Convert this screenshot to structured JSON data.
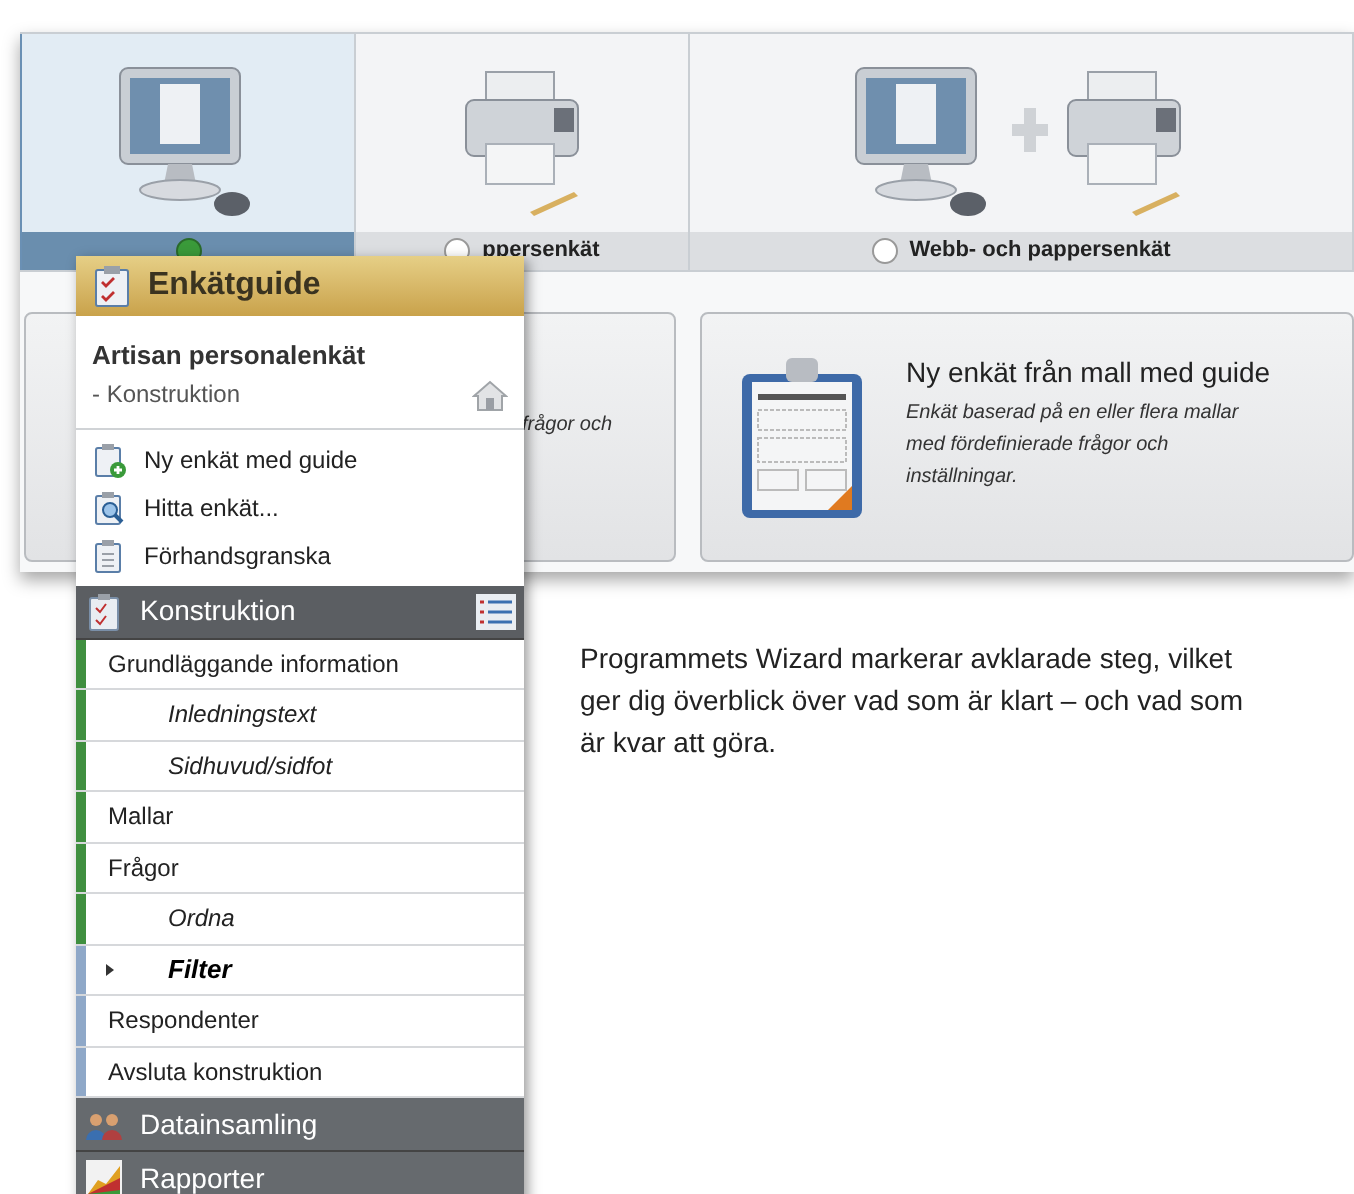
{
  "survey_types": [
    {
      "kind": "web",
      "selected": true
    },
    {
      "kind": "paper",
      "selected": false,
      "label": "ppersenkät"
    },
    {
      "kind": "both",
      "selected": false,
      "label": "Webb- och pappersenkät"
    }
  ],
  "cards": [
    {
      "kind": "blank",
      "description": "frågor och"
    },
    {
      "kind": "template",
      "title": "Ny enkät från mall med guide",
      "description": "Enkät baserad på en eller flera mallar med fördefinierade frågor och inställningar."
    }
  ],
  "wizard": {
    "title": "Enkätguide",
    "survey_name": "Artisan personalenkät",
    "survey_phase": "- Konstruktion",
    "actions": [
      {
        "kind": "new",
        "label": "Ny enkät med guide"
      },
      {
        "kind": "find",
        "label": "Hitta enkät..."
      },
      {
        "kind": "preview",
        "label": "Förhandsgranska"
      }
    ],
    "sections": [
      {
        "kind": "construction",
        "title": "Konstruktion",
        "expanded": true,
        "steps": [
          {
            "label": "Grundläggande information",
            "done": true,
            "selected": false,
            "children": [
              {
                "label": "Inledningstext",
                "done": true,
                "selected": false
              },
              {
                "label": "Sidhuvud/sidfot",
                "done": true,
                "selected": false
              }
            ]
          },
          {
            "label": "Mallar",
            "done": true,
            "selected": false
          },
          {
            "label": "Frågor",
            "done": true,
            "selected": false,
            "children": [
              {
                "label": "Ordna",
                "done": true,
                "selected": false
              },
              {
                "label": "Filter",
                "done": false,
                "selected": true
              }
            ]
          },
          {
            "label": "Respondenter",
            "done": false,
            "selected": false
          },
          {
            "label": "Avsluta konstruktion",
            "done": false,
            "selected": false
          }
        ]
      },
      {
        "kind": "collection",
        "title": "Datainsamling",
        "expanded": false
      },
      {
        "kind": "reports",
        "title": "Rapporter",
        "expanded": false
      }
    ]
  },
  "caption": "Programmets Wizard markerar avklarade steg, vilket ger dig överblick över vad som är klart – och vad som är kvar att göra."
}
